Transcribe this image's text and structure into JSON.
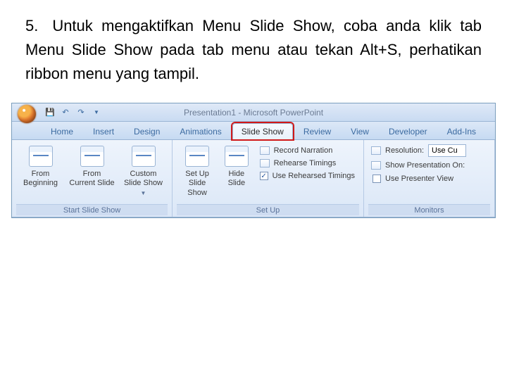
{
  "instruction": {
    "number": "5.",
    "text": "Untuk mengaktifkan Menu Slide Show, coba anda klik tab Menu Slide Show pada tab menu atau tekan Alt+S, perhatikan ribbon menu yang tampil."
  },
  "window": {
    "title": "Presentation1 - Microsoft PowerPoint",
    "qat_save_tip": "Save",
    "qat_undo_tip": "Undo",
    "qat_redo_tip": "Redo",
    "qat_customize_tip": "Customize"
  },
  "tabs": {
    "home": "Home",
    "insert": "Insert",
    "design": "Design",
    "animations": "Animations",
    "slide_show": "Slide Show",
    "review": "Review",
    "view": "View",
    "developer": "Developer",
    "addins": "Add-Ins"
  },
  "ribbon": {
    "start_group": {
      "label": "Start Slide Show",
      "from_beginning": "From Beginning",
      "from_current": "From Current Slide",
      "custom": "Custom Slide Show"
    },
    "setup_group": {
      "label": "Set Up",
      "setup": "Set Up Slide Show",
      "hide": "Hide Slide",
      "record": "Record Narration",
      "rehearse": "Rehearse Timings",
      "use_rehearsed": "Use Rehearsed Timings"
    },
    "monitors_group": {
      "label": "Monitors",
      "resolution_label": "Resolution:",
      "resolution_value": "Use Cu",
      "show_on_label": "Show Presentation On:",
      "presenter_view": "Use Presenter View"
    }
  }
}
